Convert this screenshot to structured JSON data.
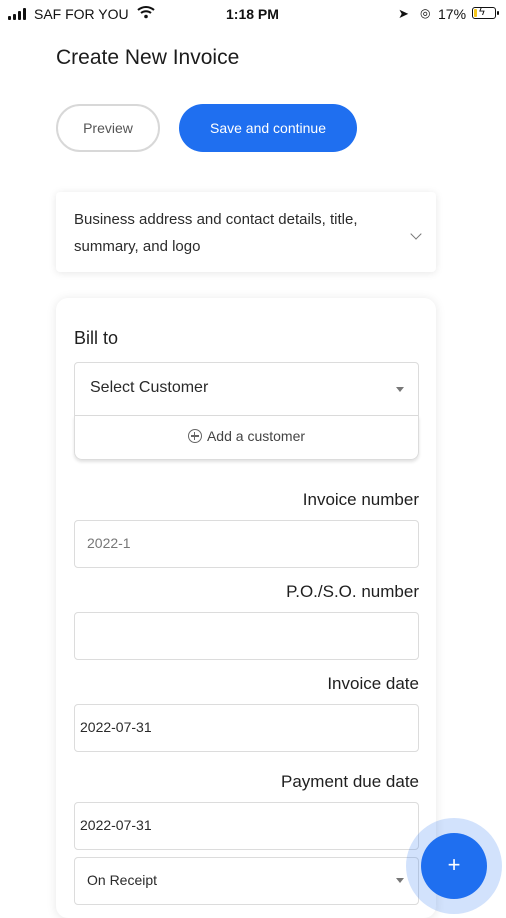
{
  "status_bar": {
    "carrier": "SAF FOR YOU",
    "time": "1:18 PM",
    "battery_percent": "17%",
    "battery_level": 0.17,
    "battery_fill_color": "#f5c518",
    "icons": [
      "signal-icon",
      "wifi-icon",
      "location-icon",
      "alarm-icon",
      "battery-icon"
    ]
  },
  "header": {
    "title": "Create New Invoice"
  },
  "actions": {
    "preview_label": "Preview",
    "save_label": "Save and continue",
    "primary_color": "#1f6ff0"
  },
  "business_section": {
    "label": "Business address and contact details, title, summary, and logo",
    "icon": "chevron-down-icon"
  },
  "bill_to": {
    "heading": "Bill to",
    "customer_select": "Select Customer",
    "add_customer_label": "Add a customer"
  },
  "invoice_fields": {
    "invoice_number_label": "Invoice number",
    "invoice_number_placeholder": "2022-1",
    "po_so_label": "P.O./S.O. number",
    "po_so_value": "",
    "invoice_date_label": "Invoice date",
    "invoice_date_value": "2022-07-31",
    "payment_due_label": "Payment due date",
    "payment_due_value": "2022-07-31",
    "payment_terms_value": "On Receipt"
  },
  "fab": {
    "label": "+"
  }
}
